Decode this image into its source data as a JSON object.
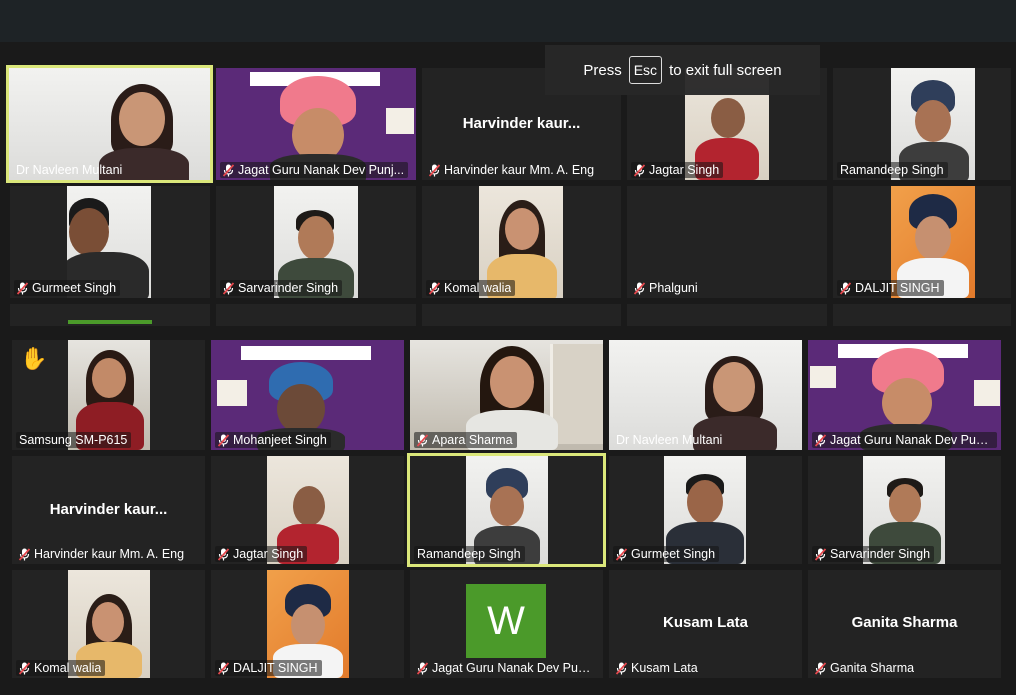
{
  "toast": {
    "prefix": "Press",
    "key": "Esc",
    "suffix": "to exit full screen"
  },
  "grid_top": [
    {
      "name": "Dr Navleen Multani",
      "muted": false,
      "active": true
    },
    {
      "name": "Jagat Guru Nanak Dev Punj...",
      "muted": true
    },
    {
      "name": "Harvinder kaur Mm. A. Eng",
      "muted": true,
      "display_name": "Harvinder  kaur..."
    },
    {
      "name": "Jagtar Singh",
      "muted": true
    },
    {
      "name": "Ramandeep Singh",
      "muted": false
    },
    {
      "name": "Gurmeet Singh",
      "muted": true
    },
    {
      "name": "Sarvarinder Singh",
      "muted": true
    },
    {
      "name": "Komal walia",
      "muted": true
    },
    {
      "name": "Phalguni",
      "muted": true
    },
    {
      "name": "DALJIT SINGH",
      "muted": true
    }
  ],
  "grid_bottom": [
    {
      "name": "Samsung SM-P615",
      "muted": false,
      "hand_raised": true
    },
    {
      "name": "Mohanjeet Singh",
      "muted": true
    },
    {
      "name": "Apara Sharma",
      "muted": true
    },
    {
      "name": "Dr Navleen Multani",
      "muted": false
    },
    {
      "name": "Jagat Guru Nanak Dev Punj...",
      "muted": true
    },
    {
      "name": "Harvinder kaur Mm. A. Eng",
      "muted": true,
      "display_name": "Harvinder  kaur..."
    },
    {
      "name": "Jagtar Singh",
      "muted": true
    },
    {
      "name": "Ramandeep Singh",
      "muted": false,
      "active": true
    },
    {
      "name": "Gurmeet Singh",
      "muted": true
    },
    {
      "name": "Sarvarinder Singh",
      "muted": true
    },
    {
      "name": "Komal walia",
      "muted": true
    },
    {
      "name": "DALJIT SINGH",
      "muted": true
    },
    {
      "name": "Jagat Guru Nanak Dev Punj...",
      "muted": true,
      "avatar_letter": "W"
    },
    {
      "name": "Kusam Lata",
      "muted": true,
      "display_name": "Kusam Lata"
    },
    {
      "name": "Ganita Sharma",
      "muted": true,
      "display_name": "Ganita Sharma"
    }
  ],
  "colors": {
    "active_border": "#dbe77a",
    "muted_mic": "#e5484d",
    "avatar_green": "#4b9a2a",
    "banner_purple": "#5b2a78"
  }
}
